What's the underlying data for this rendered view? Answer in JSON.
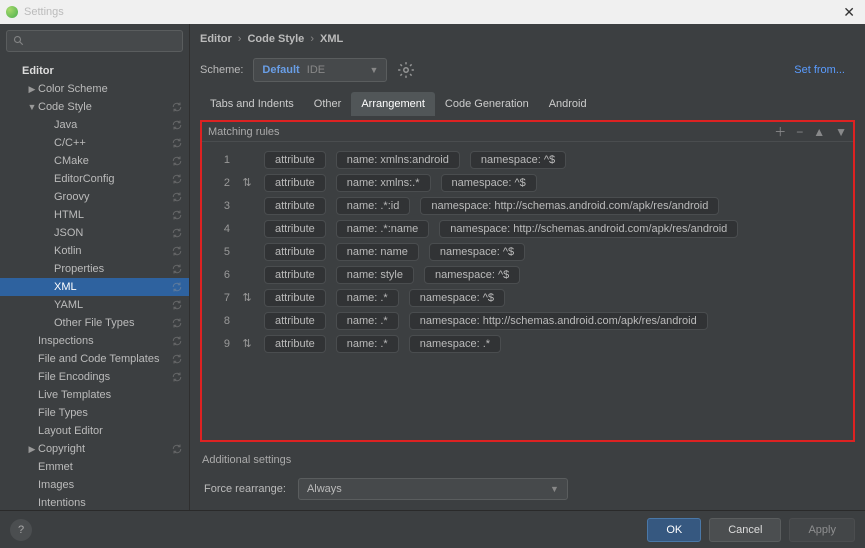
{
  "window": {
    "title": "Settings"
  },
  "search": {
    "placeholder": ""
  },
  "tree": [
    {
      "label": "Editor",
      "level": 0,
      "bold": true,
      "arrow": ""
    },
    {
      "label": "Color Scheme",
      "level": 1,
      "arrow": "▶"
    },
    {
      "label": "Code Style",
      "level": 1,
      "arrow": "▼",
      "sync": true
    },
    {
      "label": "Java",
      "level": 2,
      "sync": true
    },
    {
      "label": "C/C++",
      "level": 2,
      "sync": true
    },
    {
      "label": "CMake",
      "level": 2,
      "sync": true
    },
    {
      "label": "EditorConfig",
      "level": 2,
      "sync": true
    },
    {
      "label": "Groovy",
      "level": 2,
      "sync": true
    },
    {
      "label": "HTML",
      "level": 2,
      "sync": true
    },
    {
      "label": "JSON",
      "level": 2,
      "sync": true
    },
    {
      "label": "Kotlin",
      "level": 2,
      "sync": true
    },
    {
      "label": "Properties",
      "level": 2,
      "sync": true
    },
    {
      "label": "XML",
      "level": 2,
      "sync": true,
      "selected": true
    },
    {
      "label": "YAML",
      "level": 2,
      "sync": true
    },
    {
      "label": "Other File Types",
      "level": 2,
      "sync": true
    },
    {
      "label": "Inspections",
      "level": 1,
      "sync": true
    },
    {
      "label": "File and Code Templates",
      "level": 1,
      "sync": true
    },
    {
      "label": "File Encodings",
      "level": 1,
      "sync": true
    },
    {
      "label": "Live Templates",
      "level": 1
    },
    {
      "label": "File Types",
      "level": 1
    },
    {
      "label": "Layout Editor",
      "level": 1
    },
    {
      "label": "Copyright",
      "level": 1,
      "arrow": "▶",
      "sync": true
    },
    {
      "label": "Emmet",
      "level": 1
    },
    {
      "label": "Images",
      "level": 1
    },
    {
      "label": "Intentions",
      "level": 1
    }
  ],
  "crumb": [
    "Editor",
    "Code Style",
    "XML"
  ],
  "scheme": {
    "label": "Scheme:",
    "name": "Default",
    "suffix": "IDE"
  },
  "setfrom": "Set from...",
  "tabs": [
    {
      "label": "Tabs and Indents"
    },
    {
      "label": "Other"
    },
    {
      "label": "Arrangement",
      "active": true
    },
    {
      "label": "Code Generation"
    },
    {
      "label": "Android"
    }
  ],
  "panel": {
    "title": "Matching rules",
    "rules": [
      {
        "idx": "1",
        "sort": false,
        "attr": "attribute",
        "name": "name: xmlns:android",
        "ns": "namespace: ^$"
      },
      {
        "idx": "2",
        "sort": true,
        "attr": "attribute",
        "name": "name: xmlns:.*",
        "ns": "namespace: ^$"
      },
      {
        "idx": "3",
        "sort": false,
        "attr": "attribute",
        "name": "name: .*:id",
        "ns": "namespace: http://schemas.android.com/apk/res/android"
      },
      {
        "idx": "4",
        "sort": false,
        "attr": "attribute",
        "name": "name: .*:name",
        "ns": "namespace: http://schemas.android.com/apk/res/android"
      },
      {
        "idx": "5",
        "sort": false,
        "attr": "attribute",
        "name": "name: name",
        "ns": "namespace: ^$"
      },
      {
        "idx": "6",
        "sort": false,
        "attr": "attribute",
        "name": "name: style",
        "ns": "namespace: ^$"
      },
      {
        "idx": "7",
        "sort": true,
        "attr": "attribute",
        "name": "name: .*",
        "ns": "namespace: ^$"
      },
      {
        "idx": "8",
        "sort": false,
        "attr": "attribute",
        "name": "name: .*",
        "ns": "namespace: http://schemas.android.com/apk/res/android"
      },
      {
        "idx": "9",
        "sort": true,
        "attr": "attribute",
        "name": "name: .*",
        "ns": "namespace: .*"
      }
    ]
  },
  "additional": {
    "title": "Additional settings",
    "force_label": "Force rearrange:",
    "force_value": "Always"
  },
  "buttons": {
    "ok": "OK",
    "cancel": "Cancel",
    "apply": "Apply"
  }
}
